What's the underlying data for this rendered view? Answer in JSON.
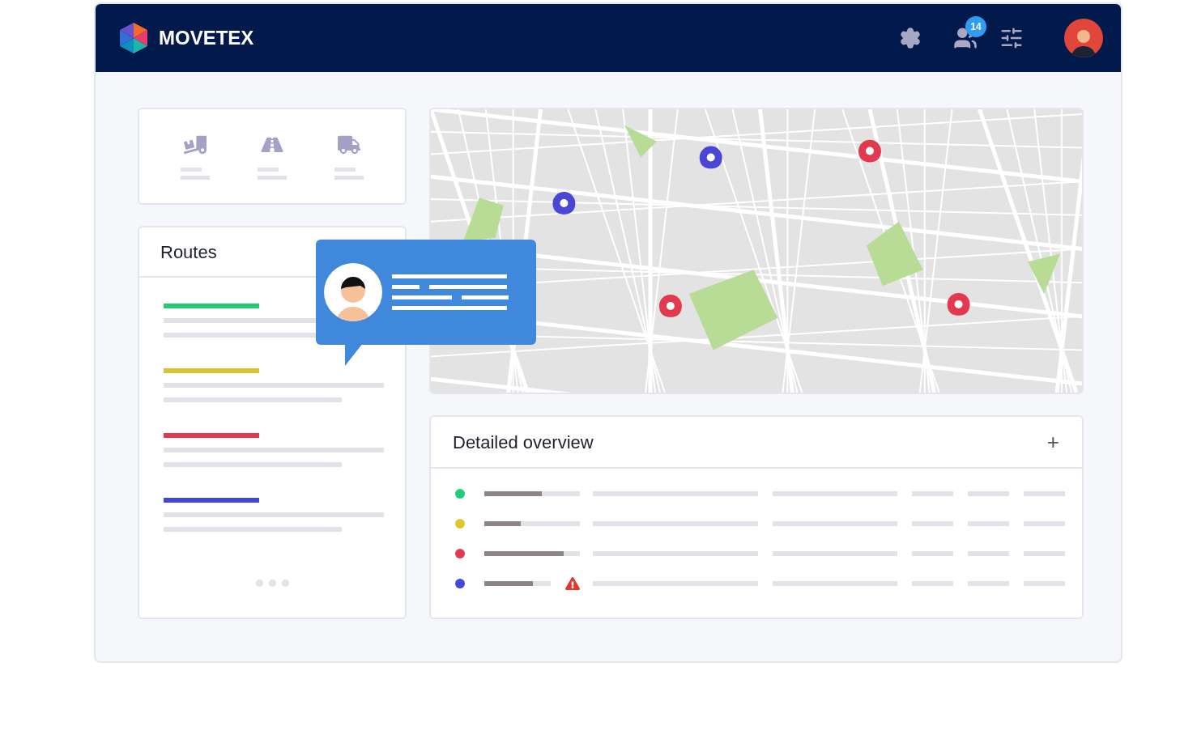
{
  "header": {
    "brand": "MOVETEX",
    "notification_count": "14"
  },
  "routes": {
    "title": "Routes",
    "items": [
      {
        "color": "#22cc77"
      },
      {
        "color": "#d9c331"
      },
      {
        "color": "#e2394f"
      },
      {
        "color": "#4446d8"
      }
    ]
  },
  "overview": {
    "title": "Detailed overview",
    "expand_symbol": "+",
    "rows": [
      {
        "color": "#22cc77",
        "level": 0.6,
        "warning": false
      },
      {
        "color": "#dfc62d",
        "level": 0.38,
        "warning": false
      },
      {
        "color": "#e2394f",
        "level": 0.83,
        "warning": false
      },
      {
        "color": "#4446d8",
        "level": 0.73,
        "warning": true
      }
    ]
  }
}
